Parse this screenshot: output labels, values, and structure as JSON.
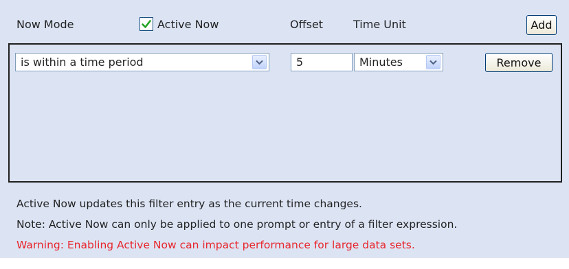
{
  "header": {
    "now_mode_label": "Now Mode",
    "active_now_label": "Active Now",
    "active_now_checked": true,
    "offset_label": "Offset",
    "time_unit_label": "Time Unit",
    "add_label": "Add"
  },
  "entries": [
    {
      "mode": "is within a time period",
      "offset": "5",
      "time_unit": "Minutes",
      "remove_label": "Remove"
    }
  ],
  "messages": {
    "info": "Active Now updates this filter entry as the current time changes.",
    "note": "Note: Active Now can only be applied to one prompt or entry of a filter expression.",
    "warning": "Warning: Enabling Active Now can impact performance for large data sets."
  },
  "colors": {
    "panel_bg": "#dce4f4",
    "warning_text": "#e8262c",
    "checkmark": "#21a121"
  },
  "icons": {
    "checkbox": "checkmark-icon",
    "dropdown": "chevron-down-icon"
  }
}
